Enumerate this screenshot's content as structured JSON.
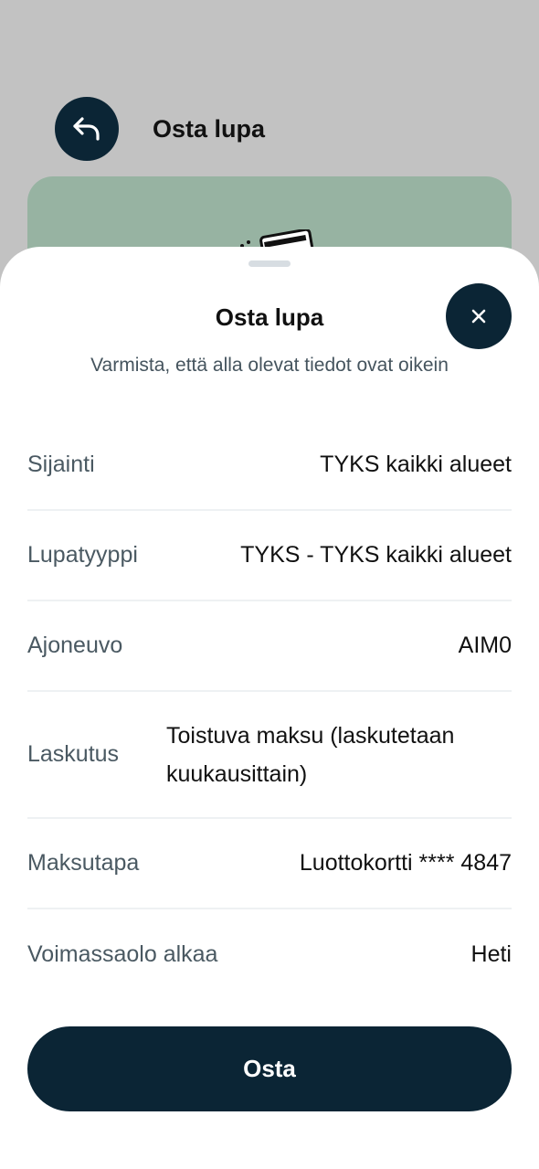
{
  "header": {
    "title": "Osta lupa",
    "back_icon": "back-arrow-icon"
  },
  "sheet": {
    "title": "Osta lupa",
    "subtitle": "Varmista, että alla olevat tiedot ovat oikein",
    "close_icon": "close-icon",
    "rows": [
      {
        "label": "Sijainti",
        "value": "TYKS kaikki alueet"
      },
      {
        "label": "Lupatyyppi",
        "value": "TYKS - TYKS kaikki alueet"
      },
      {
        "label": "Ajoneuvo",
        "value": "AIM0"
      },
      {
        "label": "Laskutus",
        "value": "Toistuva maksu (laskutetaan kuukausittain)"
      },
      {
        "label": "Maksutapa",
        "value": "Luottokortti **** 4847"
      },
      {
        "label": "Voimassaolo alkaa",
        "value": "Heti"
      }
    ],
    "buy_label": "Osta"
  },
  "colors": {
    "primary": "#0b2535",
    "card_bg": "#97b3a2",
    "overlay": "#c2c2c2"
  }
}
